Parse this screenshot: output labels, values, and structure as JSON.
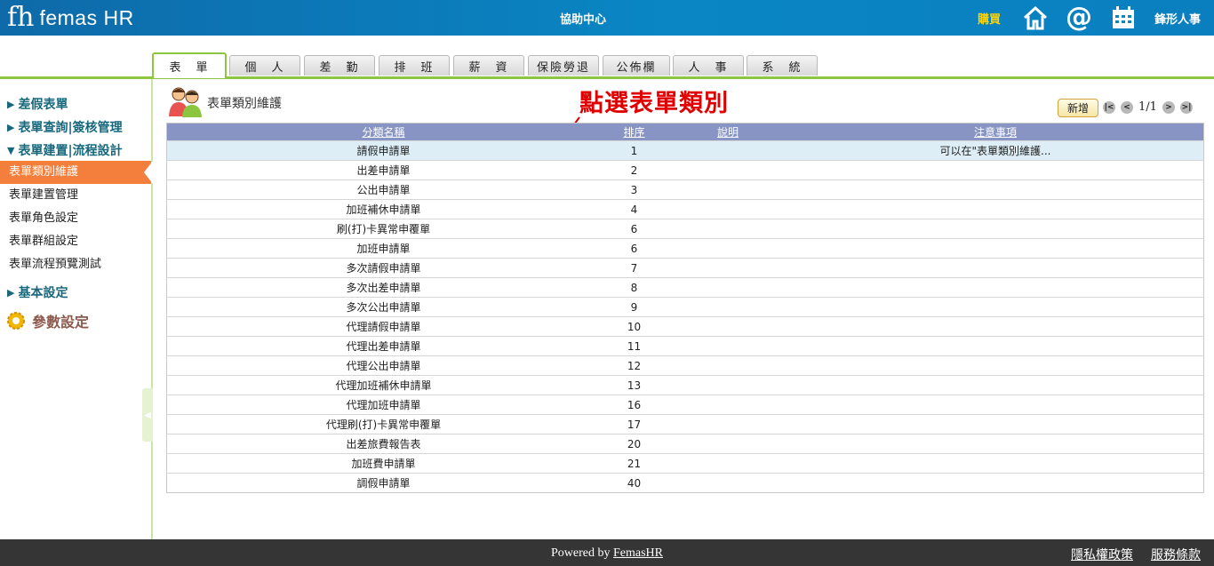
{
  "header": {
    "logo_mark": "fh",
    "logo_text": "femas HR",
    "center_title": "協助中心",
    "buy_label": "購買",
    "company_name": "鋒形人事",
    "icons": [
      "home-icon",
      "at-icon",
      "calendar-icon"
    ]
  },
  "tabs": [
    {
      "label": "表　單",
      "active": true
    },
    {
      "label": "個　人",
      "active": false
    },
    {
      "label": "差　勤",
      "active": false
    },
    {
      "label": "排　班",
      "active": false
    },
    {
      "label": "薪　資",
      "active": false
    },
    {
      "label": "保險勞退",
      "active": false
    },
    {
      "label": "公佈欄",
      "active": false
    },
    {
      "label": "人　事",
      "active": false
    },
    {
      "label": "系　統",
      "active": false
    }
  ],
  "sidebar": {
    "sections": [
      {
        "arrow": "▶",
        "label": "差假表單"
      },
      {
        "arrow": "▶",
        "label": "表單查詢|簽核管理"
      },
      {
        "arrow": "▼",
        "label": "表單建置|流程設計"
      }
    ],
    "items": [
      {
        "label": "表單類別維護",
        "active": true
      },
      {
        "label": "表單建置管理",
        "active": false
      },
      {
        "label": "表單角色設定",
        "active": false
      },
      {
        "label": "表單群組設定",
        "active": false
      },
      {
        "label": "表單流程預覽測試",
        "active": false
      }
    ],
    "basic_settings": {
      "arrow": "▶",
      "label": "基本設定"
    },
    "param_settings": "參數設定"
  },
  "main": {
    "page_title": "表單類別維護",
    "annotation": "點選表單類別",
    "add_button": "新增",
    "pager": {
      "first": "|<",
      "prev": "<",
      "info": "1/1",
      "next": ">",
      "last": ">|"
    },
    "columns": [
      "分類名稱",
      "排序",
      "說明",
      "注意事項"
    ],
    "rows": [
      {
        "name": "請假申請單",
        "order": "1",
        "desc": "",
        "note": "可以在\"表單類別維護...",
        "selected": true
      },
      {
        "name": "出差申請單",
        "order": "2",
        "desc": "",
        "note": ""
      },
      {
        "name": "公出申請單",
        "order": "3",
        "desc": "",
        "note": ""
      },
      {
        "name": "加班補休申請單",
        "order": "4",
        "desc": "",
        "note": ""
      },
      {
        "name": "刷(打)卡異常申覆單",
        "order": "6",
        "desc": "",
        "note": ""
      },
      {
        "name": "加班申請單",
        "order": "6",
        "desc": "",
        "note": ""
      },
      {
        "name": "多次請假申請單",
        "order": "7",
        "desc": "",
        "note": ""
      },
      {
        "name": "多次出差申請單",
        "order": "8",
        "desc": "",
        "note": ""
      },
      {
        "name": "多次公出申請單",
        "order": "9",
        "desc": "",
        "note": ""
      },
      {
        "name": "代理請假申請單",
        "order": "10",
        "desc": "",
        "note": ""
      },
      {
        "name": "代理出差申請單",
        "order": "11",
        "desc": "",
        "note": ""
      },
      {
        "name": "代理公出申請單",
        "order": "12",
        "desc": "",
        "note": ""
      },
      {
        "name": "代理加班補休申請單",
        "order": "13",
        "desc": "",
        "note": ""
      },
      {
        "name": "代理加班申請單",
        "order": "16",
        "desc": "",
        "note": ""
      },
      {
        "name": "代理刷(打)卡異常申覆單",
        "order": "17",
        "desc": "",
        "note": ""
      },
      {
        "name": "出差旅費報告表",
        "order": "20",
        "desc": "",
        "note": ""
      },
      {
        "name": "加班費申請單",
        "order": "21",
        "desc": "",
        "note": ""
      },
      {
        "name": "調假申請單",
        "order": "40",
        "desc": "",
        "note": ""
      }
    ]
  },
  "footer": {
    "powered_prefix": "Powered by ",
    "powered_link": "FemasHR",
    "privacy": "隱私權政策",
    "terms": "服務條款"
  },
  "colors": {
    "header_blue": "#0a86c4",
    "tab_green": "#8dc63f",
    "active_orange": "#f47f3c",
    "table_header": "#8794c4",
    "annotation_red": "#e00000"
  }
}
